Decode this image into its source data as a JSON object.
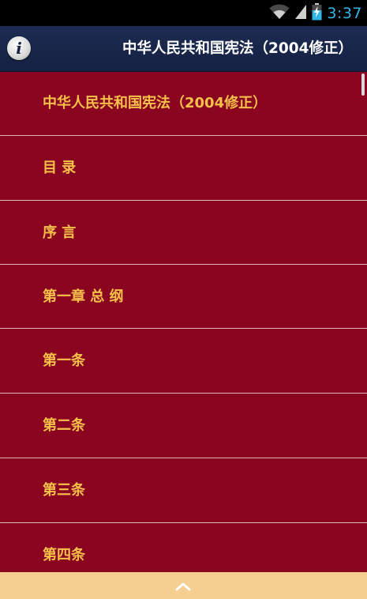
{
  "status_bar": {
    "time": "3:37",
    "time_color": "#33b5e5",
    "icons": [
      "wifi-icon",
      "signal-icon",
      "battery-charging-icon"
    ]
  },
  "action_bar": {
    "title": "中华人民共和国宪法（2004修正）",
    "info_icon_glyph": "i",
    "background": "#1c2b52"
  },
  "list": {
    "background": "#8a0620",
    "text_color": "#f7c04a",
    "items": [
      {
        "label": "中华人民共和国宪法（2004修正）"
      },
      {
        "label": "目 录"
      },
      {
        "label": "序 言"
      },
      {
        "label": "第一章 总 纲"
      },
      {
        "label": "第一条"
      },
      {
        "label": "第二条"
      },
      {
        "label": "第三条"
      },
      {
        "label": "第四条"
      }
    ]
  },
  "bottom_bar": {
    "icon": "chevron-up-icon",
    "background": "#f5cf90"
  }
}
